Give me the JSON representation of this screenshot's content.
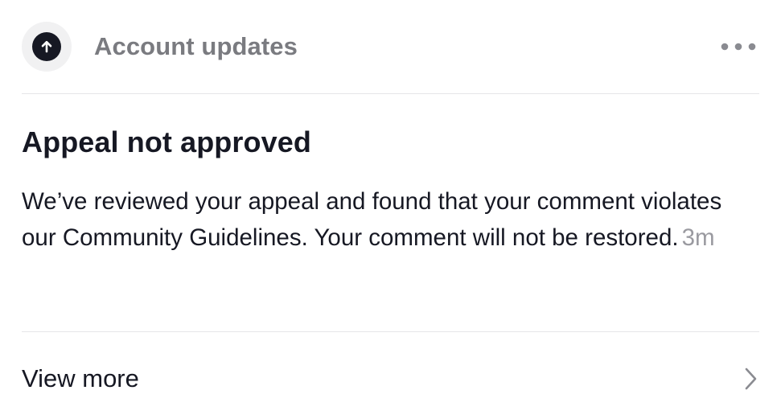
{
  "header": {
    "title": "Account updates",
    "icon": "arrow-up-circle-icon",
    "more_icon": "more-horizontal-icon"
  },
  "notification": {
    "title": "Appeal not approved",
    "body": "We’ve reviewed your appeal and found that your comment violates our Community Guidelines. Your comment will not be restored.",
    "timestamp": "3m"
  },
  "footer": {
    "view_more_label": "View more",
    "chevron_icon": "chevron-right-icon"
  },
  "colors": {
    "text_primary": "#161823",
    "text_secondary": "#7a7b80",
    "timestamp": "#9a9aa0",
    "divider": "#e6e6e8",
    "avatar_bg": "#f1f1f2"
  }
}
